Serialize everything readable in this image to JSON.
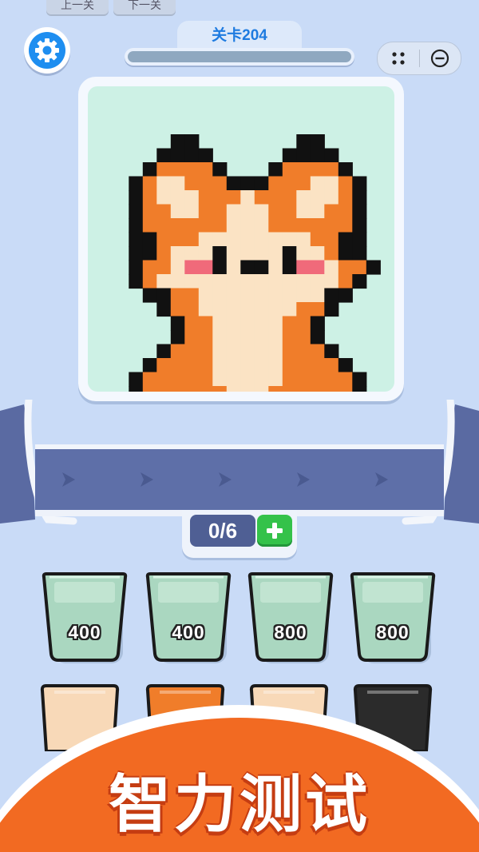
{
  "nav": {
    "prev": "上一关",
    "next": "下一关"
  },
  "level": {
    "title": "关卡204",
    "progress": 0
  },
  "colors": {
    "black": "#111111",
    "orange": "#f07d2a",
    "orange_light": "#f5a45c",
    "cream": "#fbe3c4",
    "cream_dark": "#f3cfa2",
    "blush": "#f06a7a",
    "board_bg": "#cdf1e5",
    "bucket": "#aad7c0",
    "accent_blue": "#1e8ef0",
    "banner": "#f26a22"
  },
  "icons": {
    "settings": "gear-icon",
    "menu": "dots-icon",
    "close": "minus-circle-icon",
    "add": "plus-icon",
    "conveyor": "chevron-right-icon"
  },
  "counter": {
    "text": "0/6"
  },
  "buckets": [
    {
      "label": "400"
    },
    {
      "label": "400"
    },
    {
      "label": "800"
    },
    {
      "label": "800"
    }
  ],
  "back_buckets": [
    {
      "color": "#f8d9b8"
    },
    {
      "color": "#f07d2a"
    },
    {
      "color": "#f8d9b8"
    },
    {
      "color": "#2b2b2b"
    }
  ],
  "banner": {
    "text": "智力测试"
  }
}
